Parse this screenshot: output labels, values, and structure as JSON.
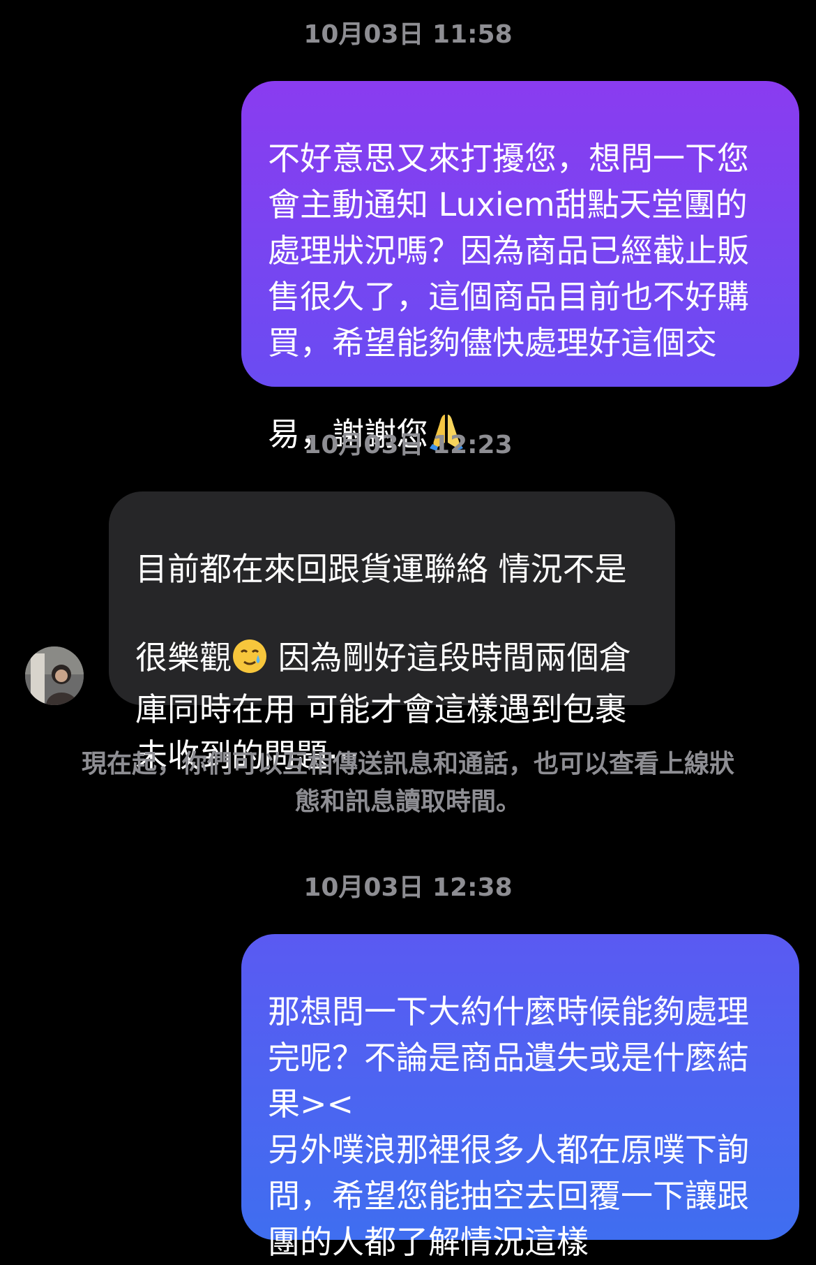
{
  "conversation": {
    "messages": [
      {
        "timestamp": "10月03日 11:58",
        "sender": "me",
        "text": "不好意思又來打擾您，想問一下您會主動通知 Luxiem甜點天堂團的處理狀況嗎？因為商品已經截止販售很久了，這個商品目前也不好購買，希望能夠儘快處理好這個交易，謝謝您",
        "emoji": "folded-hands",
        "bubble_color": "#7b3ff2"
      },
      {
        "timestamp": "10月03日 12:23",
        "sender": "other",
        "text_part1": "目前都在來回跟貨運聯絡 情況不是很樂觀",
        "emoji": "smiling-face-with-tear",
        "text_part2": " 因為剛好這段時間兩個倉庫同時在用 可能才會這樣遇到包裹未收到的問題⋯",
        "bubble_color": "#262628"
      },
      {
        "timestamp": "10月03日 12:38",
        "sender": "me",
        "text": "那想問一下大約什麼時候能夠處理完呢？不論是商品遺失或是什麼結果><\n另外噗浪那裡很多人都在原噗下詢問，希望您能抽空去回覆一下讓跟團的人都了解情況這樣",
        "bubble_color": "#4a63ee"
      }
    ],
    "notice": "現在起，你們可以互相傳送訊息和通話，也可以查看上線狀\n態和訊息讀取時間。"
  },
  "colors": {
    "background": "#000000",
    "timestamp_text": "#8e8e93",
    "sent_gradient_top": "#8a3cf0",
    "sent_gradient_bottom": "#5a50f0",
    "sent_gradient2_top": "#5a5af2",
    "sent_gradient2_bottom": "#3f6ef0",
    "received_bubble": "#262628"
  }
}
